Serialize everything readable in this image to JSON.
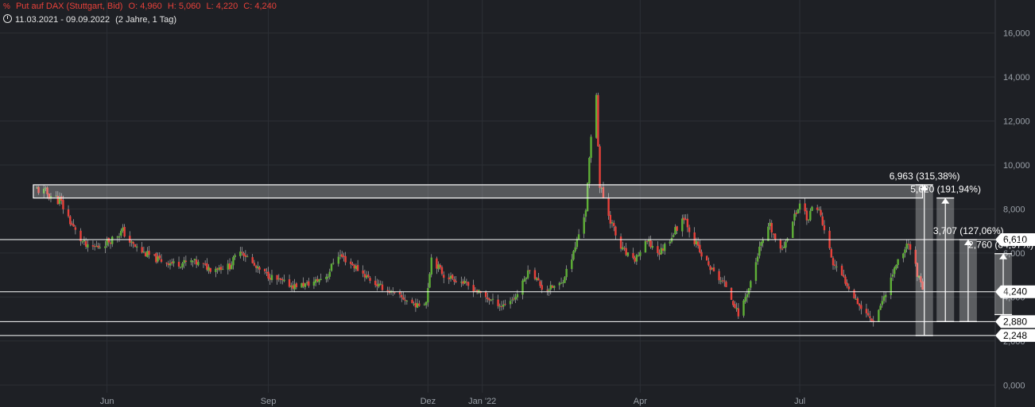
{
  "header": {
    "symbol_icon": "percent-chart-icon",
    "symbol_glyph": "%",
    "instrument": "Put auf DAX (Stuttgart, Bid)",
    "open": "O: 4,960",
    "high": "H: 5,060",
    "low": "L: 4,220",
    "close": "C: 4,240",
    "clock_icon": "clock-icon",
    "range": "11.03.2021 - 09.09.2022",
    "period": "(2 Jahre, 1 Tag)"
  },
  "colors": {
    "background": "#1e2025",
    "up": "#5fb037",
    "down": "#e8413a",
    "grid": "#2c2f35",
    "line": "#ffffff",
    "text": "#9aa0a8"
  },
  "chart_data": {
    "type": "candlestick",
    "title": "Put auf DAX (Stuttgart, Bid)",
    "x_range": [
      "2021-03-11",
      "2022-09-09"
    ],
    "xlim": [
      "2021-04-01",
      "2022-10-20"
    ],
    "ylim": [
      -1.0,
      17.5
    ],
    "y_ticks": [
      0,
      2,
      4,
      6,
      8,
      10,
      12,
      14,
      16
    ],
    "y_tick_labels": [
      "0,000",
      "2,000",
      "4,000",
      "6,000",
      "8,000",
      "10,000",
      "12,000",
      "14,000",
      "16,000"
    ],
    "x_ticks": [
      "2021-06-01",
      "2021-09-01",
      "2021-12-01",
      "2022-01-01",
      "2022-04-01",
      "2022-07-01"
    ],
    "x_tick_labels": [
      "Jun",
      "Sep",
      "Dez",
      "Jan '22",
      "Apr",
      "Jul"
    ],
    "grid": true,
    "close_path": [
      [
        "2021-04-22",
        8.9
      ],
      [
        "2021-04-28",
        8.7
      ],
      [
        "2021-05-05",
        8.4
      ],
      [
        "2021-05-10",
        7.6
      ],
      [
        "2021-05-15",
        6.8
      ],
      [
        "2021-05-21",
        6.2
      ],
      [
        "2021-05-27",
        6.3
      ],
      [
        "2021-06-03",
        6.6
      ],
      [
        "2021-06-10",
        7.0
      ],
      [
        "2021-06-15",
        6.4
      ],
      [
        "2021-06-22",
        6.0
      ],
      [
        "2021-06-30",
        5.7
      ],
      [
        "2021-07-10",
        5.5
      ],
      [
        "2021-07-20",
        5.6
      ],
      [
        "2021-07-30",
        5.3
      ],
      [
        "2021-08-10",
        5.4
      ],
      [
        "2021-08-16",
        6.2
      ],
      [
        "2021-08-25",
        5.3
      ],
      [
        "2021-09-05",
        4.8
      ],
      [
        "2021-09-15",
        4.5
      ],
      [
        "2021-09-25",
        4.6
      ],
      [
        "2021-10-05",
        5.0
      ],
      [
        "2021-10-10",
        6.0
      ],
      [
        "2021-10-20",
        5.4
      ],
      [
        "2021-11-01",
        4.6
      ],
      [
        "2021-11-15",
        4.0
      ],
      [
        "2021-11-25",
        3.6
      ],
      [
        "2021-11-30",
        3.8
      ],
      [
        "2021-12-03",
        5.8
      ],
      [
        "2021-12-10",
        5.0
      ],
      [
        "2021-12-20",
        4.7
      ],
      [
        "2022-01-05",
        3.9
      ],
      [
        "2022-01-12",
        3.6
      ],
      [
        "2022-01-20",
        4.0
      ],
      [
        "2022-01-28",
        5.3
      ],
      [
        "2022-02-05",
        4.3
      ],
      [
        "2022-02-15",
        4.6
      ],
      [
        "2022-02-22",
        6.0
      ],
      [
        "2022-03-01",
        8.0
      ],
      [
        "2022-03-04",
        11.2
      ],
      [
        "2022-03-07",
        13.3
      ],
      [
        "2022-03-09",
        9.0
      ],
      [
        "2022-03-14",
        7.8
      ],
      [
        "2022-03-20",
        6.3
      ],
      [
        "2022-03-28",
        5.6
      ],
      [
        "2022-04-05",
        6.5
      ],
      [
        "2022-04-12",
        6.0
      ],
      [
        "2022-04-20",
        6.9
      ],
      [
        "2022-04-26",
        7.7
      ],
      [
        "2022-05-05",
        6.0
      ],
      [
        "2022-05-12",
        5.2
      ],
      [
        "2022-05-20",
        4.5
      ],
      [
        "2022-05-27",
        3.2
      ],
      [
        "2022-06-02",
        4.4
      ],
      [
        "2022-06-08",
        6.2
      ],
      [
        "2022-06-14",
        7.2
      ],
      [
        "2022-06-20",
        6.0
      ],
      [
        "2022-06-26",
        7.2
      ],
      [
        "2022-07-01",
        8.3
      ],
      [
        "2022-07-06",
        7.5
      ],
      [
        "2022-07-10",
        8.5
      ],
      [
        "2022-07-15",
        7.0
      ],
      [
        "2022-07-20",
        5.5
      ],
      [
        "2022-07-28",
        4.6
      ],
      [
        "2022-08-05",
        3.5
      ],
      [
        "2022-08-12",
        2.9
      ],
      [
        "2022-08-18",
        4.0
      ],
      [
        "2022-08-25",
        5.5
      ],
      [
        "2022-09-01",
        6.5
      ],
      [
        "2022-09-09",
        4.24
      ]
    ],
    "horizontal_lines": [
      {
        "value": 6.61,
        "label": "6,610"
      },
      {
        "value": 4.24,
        "label": "4,240"
      },
      {
        "value": 2.88,
        "label": "2,880"
      },
      {
        "value": 2.248,
        "label": "2,248"
      }
    ],
    "resistance_zone": {
      "from_date": "2021-04-20",
      "to_date": "2022-09-09",
      "low": 8.5,
      "high": 9.1
    },
    "measurements": [
      {
        "date": "2022-09-10",
        "from": 2.248,
        "to": 9.1,
        "label": "6,963 (315,38%)"
      },
      {
        "date": "2022-09-22",
        "from": 2.88,
        "to": 8.5,
        "label": "5,620 (191,94%)"
      },
      {
        "date": "2022-10-05",
        "from": 2.88,
        "to": 6.61,
        "label": "3,707 (127,06%)"
      },
      {
        "date": "2022-10-25",
        "from": 3.2,
        "to": 5.97,
        "label": "2,760 (84,97%)"
      }
    ]
  }
}
